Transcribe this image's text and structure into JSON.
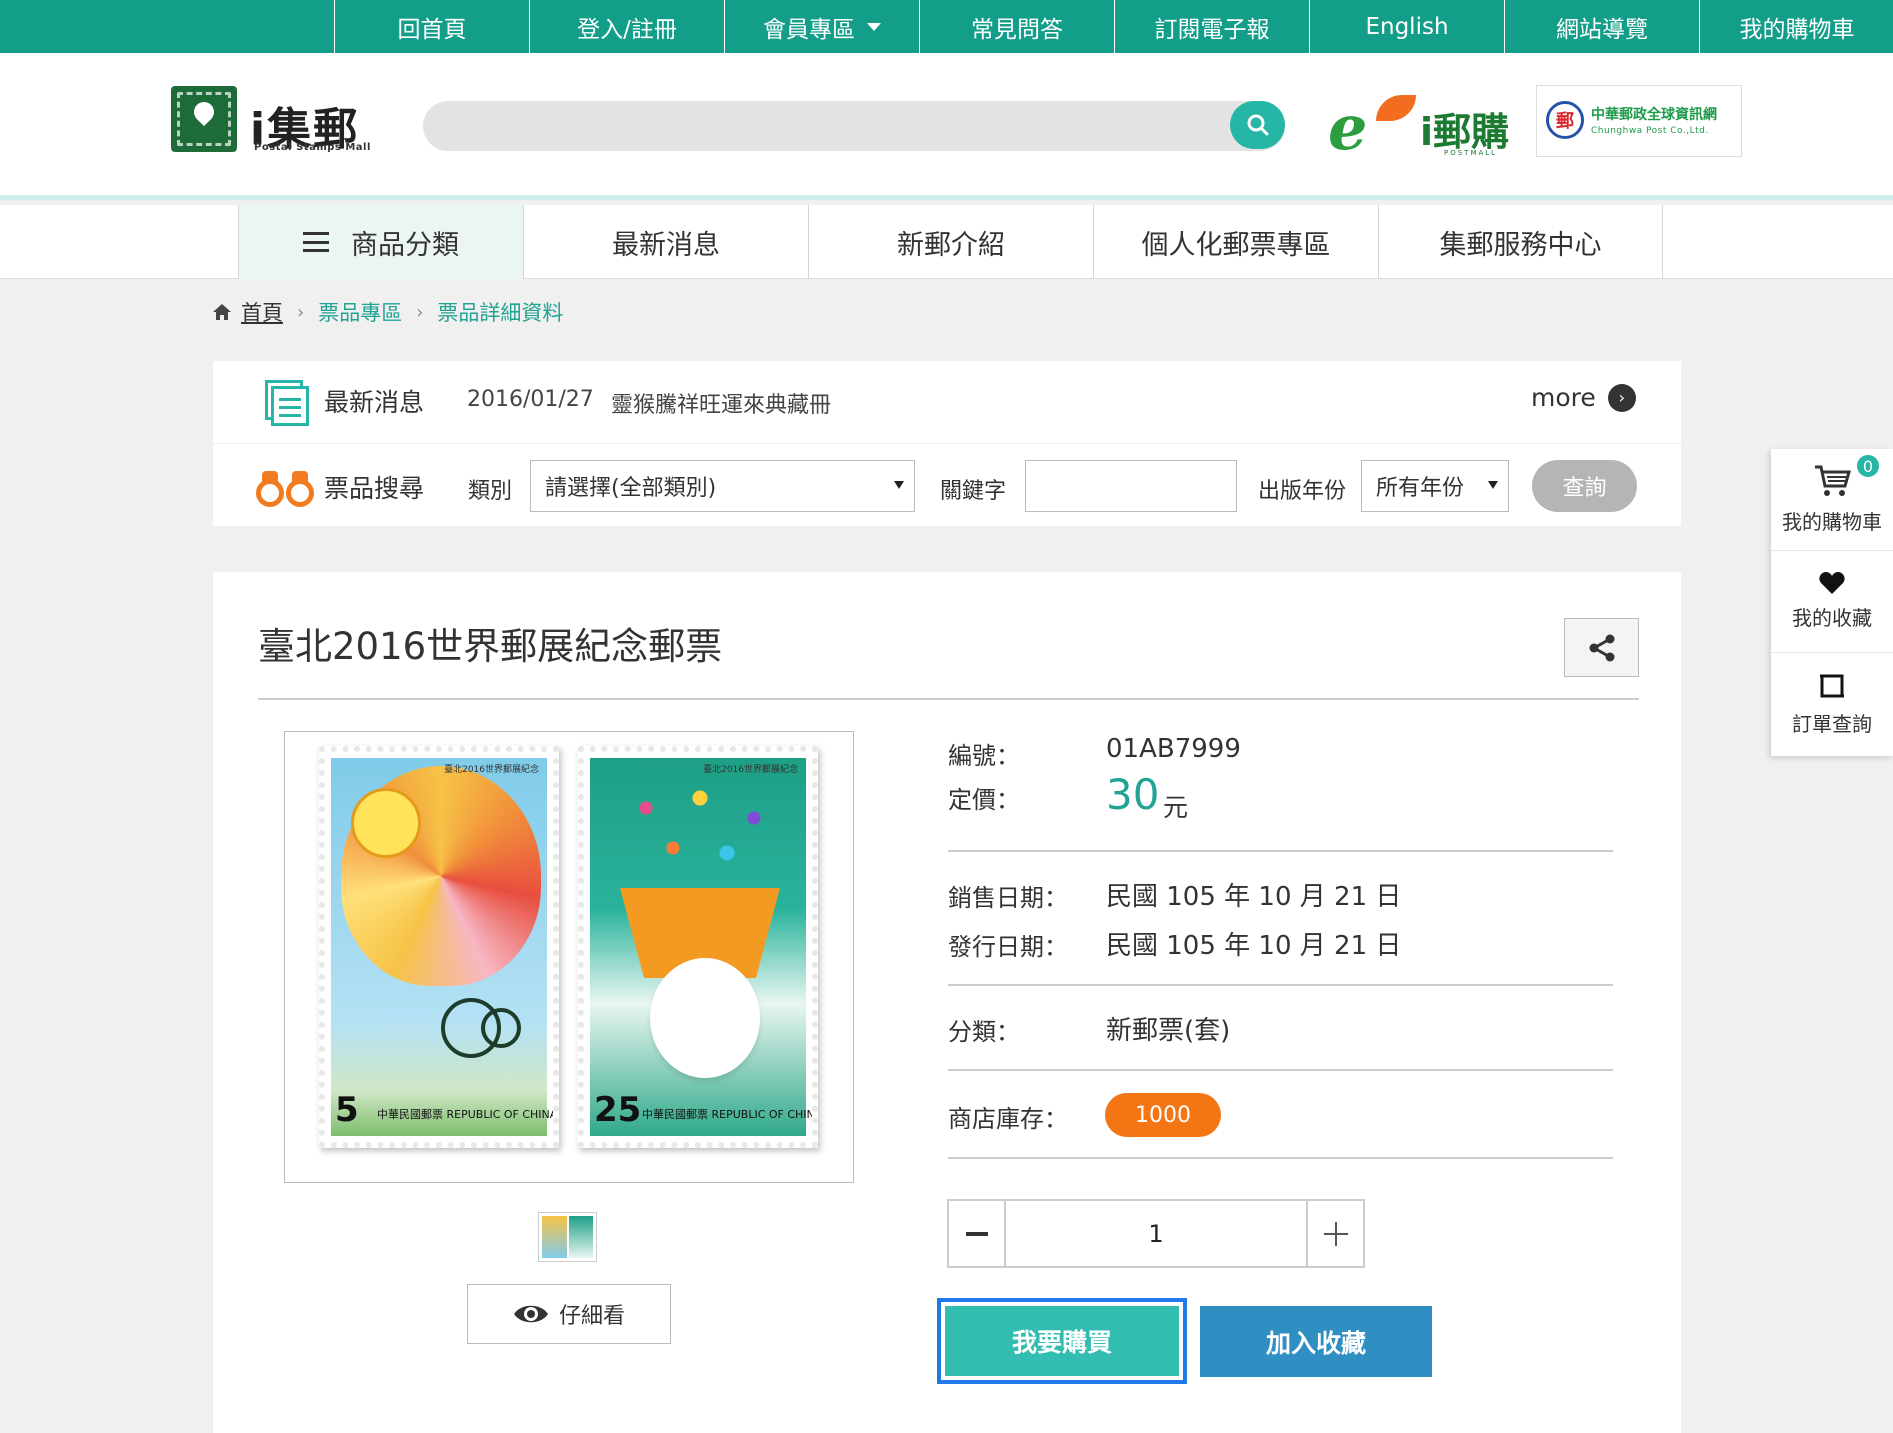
{
  "topnav": {
    "items": [
      "回首頁",
      "登入/註冊",
      "會員專區",
      "常見問答",
      "訂閱電子報",
      "English",
      "網站導覽",
      "我的購物車"
    ]
  },
  "header": {
    "logo_title": "i集郵",
    "logo_sub": "Postal Stamps Mall",
    "search_placeholder": "",
    "postmall_text": "i郵購",
    "postmall_small": "POSTMALL",
    "cpost_seal": "郵",
    "cpost_zh": "中華郵政全球資訊網",
    "cpost_en": "Chunghwa Post Co.,Ltd."
  },
  "mainnav": {
    "items": [
      "商品分類",
      "最新消息",
      "新郵介紹",
      "個人化郵票專區",
      "集郵服務中心"
    ]
  },
  "breadcrumb": {
    "home": "首頁",
    "level1": "票品專區",
    "level2": "票品詳細資料"
  },
  "news": {
    "label": "最新消息",
    "date": "2016/01/27",
    "text": "靈猴騰祥旺運來典藏冊",
    "more": "more"
  },
  "stamp_search": {
    "label": "票品搜尋",
    "category_label": "類別",
    "category_value": "請選擇(全部類別)",
    "keyword_label": "關鍵字",
    "keyword_value": "",
    "year_label": "出版年份",
    "year_value": "所有年份",
    "query_button": "查詢"
  },
  "floatbar": {
    "cart_label": "我的購物車",
    "cart_count": "0",
    "favorites_label": "我的收藏",
    "orders_label": "訂單查詢"
  },
  "product": {
    "title": "臺北2016世界郵展紀念郵票",
    "number_label": "編號：",
    "number": "01AB7999",
    "price_label": "定價：",
    "price": "30",
    "price_unit": "元",
    "sale_date_label": "銷售日期：",
    "sale_date": "民國 105 年 10 月 21 日",
    "issue_date_label": "發行日期：",
    "issue_date": "民國 105 年 10 月 21 日",
    "category_label": "分類：",
    "category": "新郵票(套)",
    "stock_label": "商店庫存：",
    "stock": "1000",
    "quantity": "1",
    "detail_button": "仔細看",
    "buy_button": "我要購買",
    "favorite_button": "加入收藏",
    "stamp1_denom": "5",
    "stamp2_denom": "25",
    "stamp_caption": "中華民國郵票 REPUBLIC OF CHINA (TAIWAN)",
    "stamp_top_text": "臺北2016世界郵展紀念"
  },
  "colors": {
    "brand_green": "#139e8a",
    "accent_teal": "#25b6a6",
    "stock_orange": "#f47514",
    "favorite_blue": "#2f8fc2"
  }
}
